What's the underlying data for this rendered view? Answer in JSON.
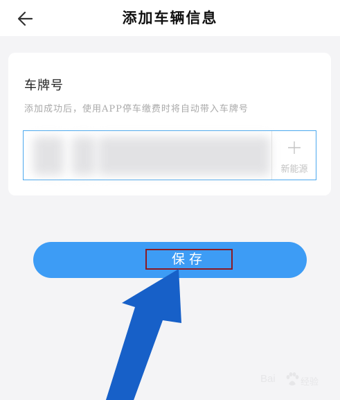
{
  "header": {
    "title": "添加车辆信息",
    "back_icon": "arrow-left-icon"
  },
  "plate_section": {
    "title": "车牌号",
    "hint": "添加成功后，使用APP停车缴费时将自动带入车牌号",
    "plate_value": "",
    "new_energy_label": "新能源",
    "new_energy_icon": "plus-icon",
    "accent_color": "#4aa8ee"
  },
  "actions": {
    "save_label": "保存",
    "save_color": "#3d9cf5",
    "highlight_color": "#8a1a23"
  },
  "annotation": {
    "arrow_color": "#1760c8",
    "arrow_icon": "pointer-arrow-icon"
  },
  "watermark": {
    "brand_left": "Bai",
    "brand_right": "经验",
    "paw_icon": "baidu-paw-icon"
  }
}
